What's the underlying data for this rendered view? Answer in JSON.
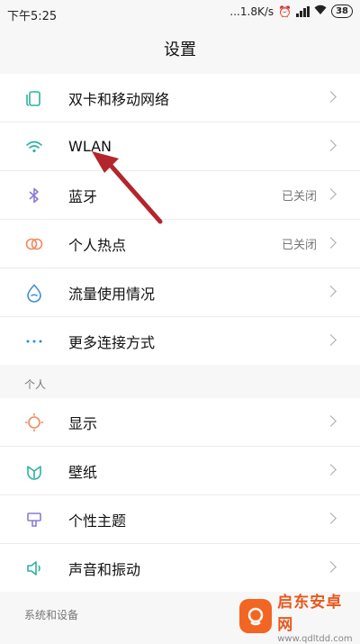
{
  "status_bar": {
    "time": "下午5:25",
    "network_speed": "...1.8K/s",
    "battery": "38"
  },
  "page_title": "设置",
  "connectivity_items": [
    {
      "label": "双卡和移动网络",
      "value": "",
      "icon": "sim-card-icon"
    },
    {
      "label": "WLAN",
      "value": "",
      "icon": "wifi-icon"
    },
    {
      "label": "蓝牙",
      "value": "已关闭",
      "icon": "bluetooth-icon"
    },
    {
      "label": "个人热点",
      "value": "已关闭",
      "icon": "hotspot-icon"
    },
    {
      "label": "流量使用情况",
      "value": "",
      "icon": "data-usage-icon"
    },
    {
      "label": "更多连接方式",
      "value": "",
      "icon": "more-dots-icon"
    }
  ],
  "personal_section": {
    "header": "个人",
    "items": [
      {
        "label": "显示",
        "icon": "display-icon"
      },
      {
        "label": "壁纸",
        "icon": "wallpaper-icon"
      },
      {
        "label": "个性主题",
        "icon": "theme-icon"
      },
      {
        "label": "声音和振动",
        "icon": "sound-icon"
      }
    ]
  },
  "system_section": {
    "header": "系统和设备"
  },
  "colors": {
    "accent_teal": "#2bb3a0",
    "bluetooth_purple": "#8a7bd8",
    "hotspot_orange": "#f08a5d",
    "data_blue": "#3b8fd8",
    "annotation_arrow": "#b3262c"
  },
  "watermark": {
    "title": "启东安卓网",
    "url": "www.qdltdd.com"
  }
}
